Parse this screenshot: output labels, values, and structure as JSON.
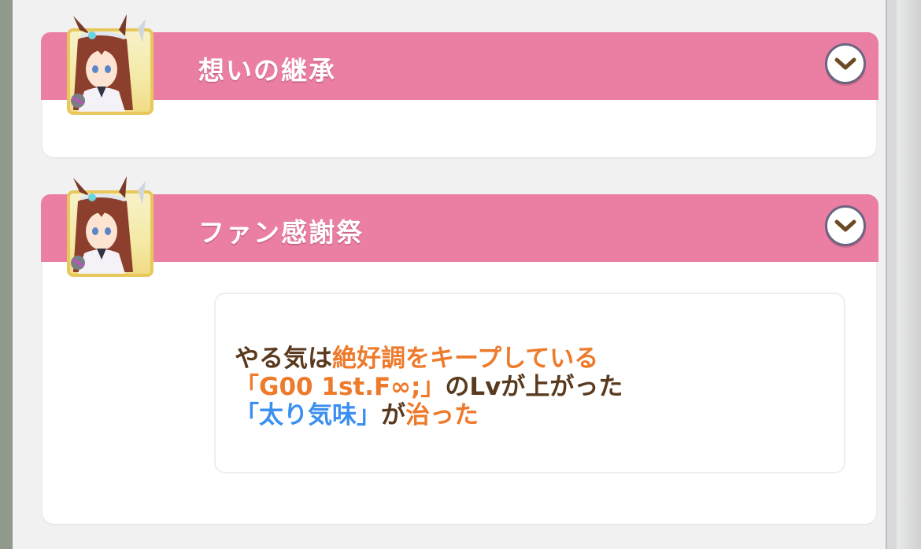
{
  "sections": [
    {
      "title": "想いの継承",
      "expand_icon": "chevron-down-icon",
      "portrait": "character-portrait"
    },
    {
      "title": "ファン感謝祭",
      "expand_icon": "chevron-down-icon",
      "portrait": "character-portrait",
      "effects": {
        "line1": [
          "やる気は",
          "絶好調をキープしている"
        ],
        "line2": [
          "「G00 1st.F∞;」",
          "のLvが上がった"
        ],
        "line3": [
          "「太り気味」",
          "が",
          "治った"
        ]
      }
    }
  ],
  "colors": {
    "band": "#ea7ea3",
    "text_brown": "#5a3a1e",
    "text_orange": "#ee7a2c",
    "text_blue": "#3b8ff0",
    "portrait_frame": "#e8c85b"
  }
}
